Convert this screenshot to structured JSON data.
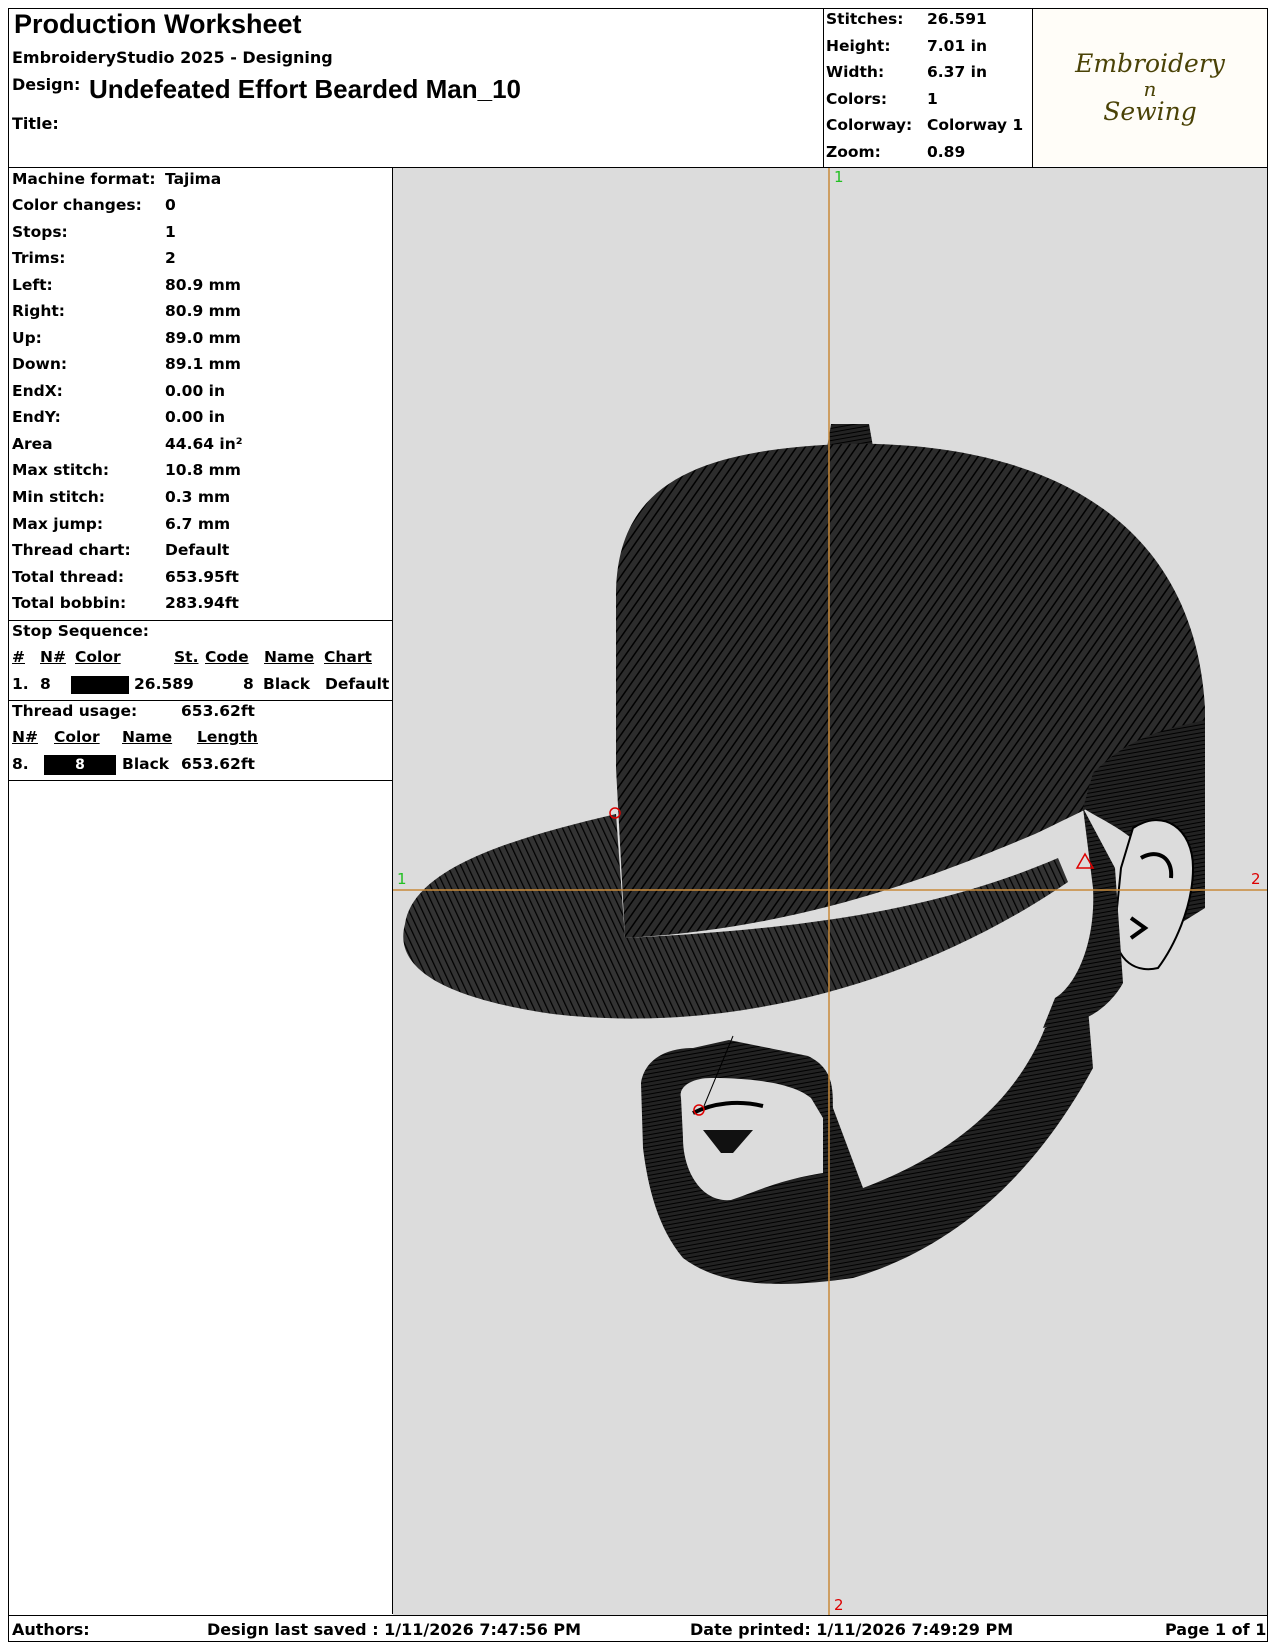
{
  "header": {
    "title": "Production Worksheet",
    "software": "EmbroideryStudio 2025 - Designing",
    "design_label": "Design:",
    "design_name": "Undefeated Effort Bearded Man_10",
    "title_label": "Title:",
    "title_value": ""
  },
  "summary": {
    "stitches_label": "Stitches:",
    "stitches": "26.591",
    "height_label": "Height:",
    "height": "7.01 in",
    "width_label": "Width:",
    "width": "6.37 in",
    "colors_label": "Colors:",
    "colors": "1",
    "colorway_label": "Colorway:",
    "colorway": "Colorway 1",
    "zoom_label": "Zoom:",
    "zoom": "0.89"
  },
  "logo": {
    "line1": "Embroidery",
    "line2": "n",
    "line3": "Sewing"
  },
  "details": [
    {
      "label": "Machine format:",
      "value": "Tajima"
    },
    {
      "label": "Color changes:",
      "value": "0"
    },
    {
      "label": "Stops:",
      "value": "1"
    },
    {
      "label": "Trims:",
      "value": "2"
    },
    {
      "label": "Left:",
      "value": "80.9 mm"
    },
    {
      "label": "Right:",
      "value": "80.9 mm"
    },
    {
      "label": "Up:",
      "value": "89.0 mm"
    },
    {
      "label": "Down:",
      "value": "89.1 mm"
    },
    {
      "label": "EndX:",
      "value": "0.00 in"
    },
    {
      "label": "EndY:",
      "value": "0.00 in"
    },
    {
      "label": "Area",
      "value": " 44.64 in²"
    },
    {
      "label": "Max stitch:",
      "value": "10.8 mm"
    },
    {
      "label": "Min stitch:",
      "value": "0.3 mm"
    },
    {
      "label": "Max jump:",
      "value": "6.7 mm"
    },
    {
      "label": "Thread chart:",
      "value": "Default"
    },
    {
      "label": "Total thread:",
      "value": "653.95ft"
    },
    {
      "label": "Total bobbin:",
      "value": "283.94ft"
    }
  ],
  "stop_sequence": {
    "title": "Stop Sequence:",
    "headers": [
      "#",
      "N#",
      "Color",
      "St.",
      "Code",
      "Name",
      "Chart"
    ],
    "row": {
      "num": "1.",
      "n": "8",
      "stitches": "26.589",
      "code": "8",
      "name": "Black",
      "chart": "Default",
      "color": "#000000"
    }
  },
  "thread_usage": {
    "title": "Thread usage:",
    "total": "653.62ft",
    "headers": [
      "N#",
      "Color",
      "Name",
      "Length"
    ],
    "row": {
      "n": "8.",
      "swatch_label": "8",
      "name": "Black",
      "length": "653.62ft",
      "color": "#000000"
    }
  },
  "canvas": {
    "background": "#dcdcdc",
    "axis_color": "#c88a3a",
    "marker_color": "#22c022",
    "vertical_top_label": "1",
    "vertical_bottom_label": "2",
    "horizontal_left_label": "1",
    "horizontal_right_label": "2",
    "design_fill": "#1a1a1a"
  },
  "footer": {
    "authors": "Authors:",
    "saved": "Design last saved : 1/11/2026 7:47:56 PM",
    "printed": "Date printed: 1/11/2026 7:49:29 PM",
    "page": "Page 1 of 1"
  }
}
